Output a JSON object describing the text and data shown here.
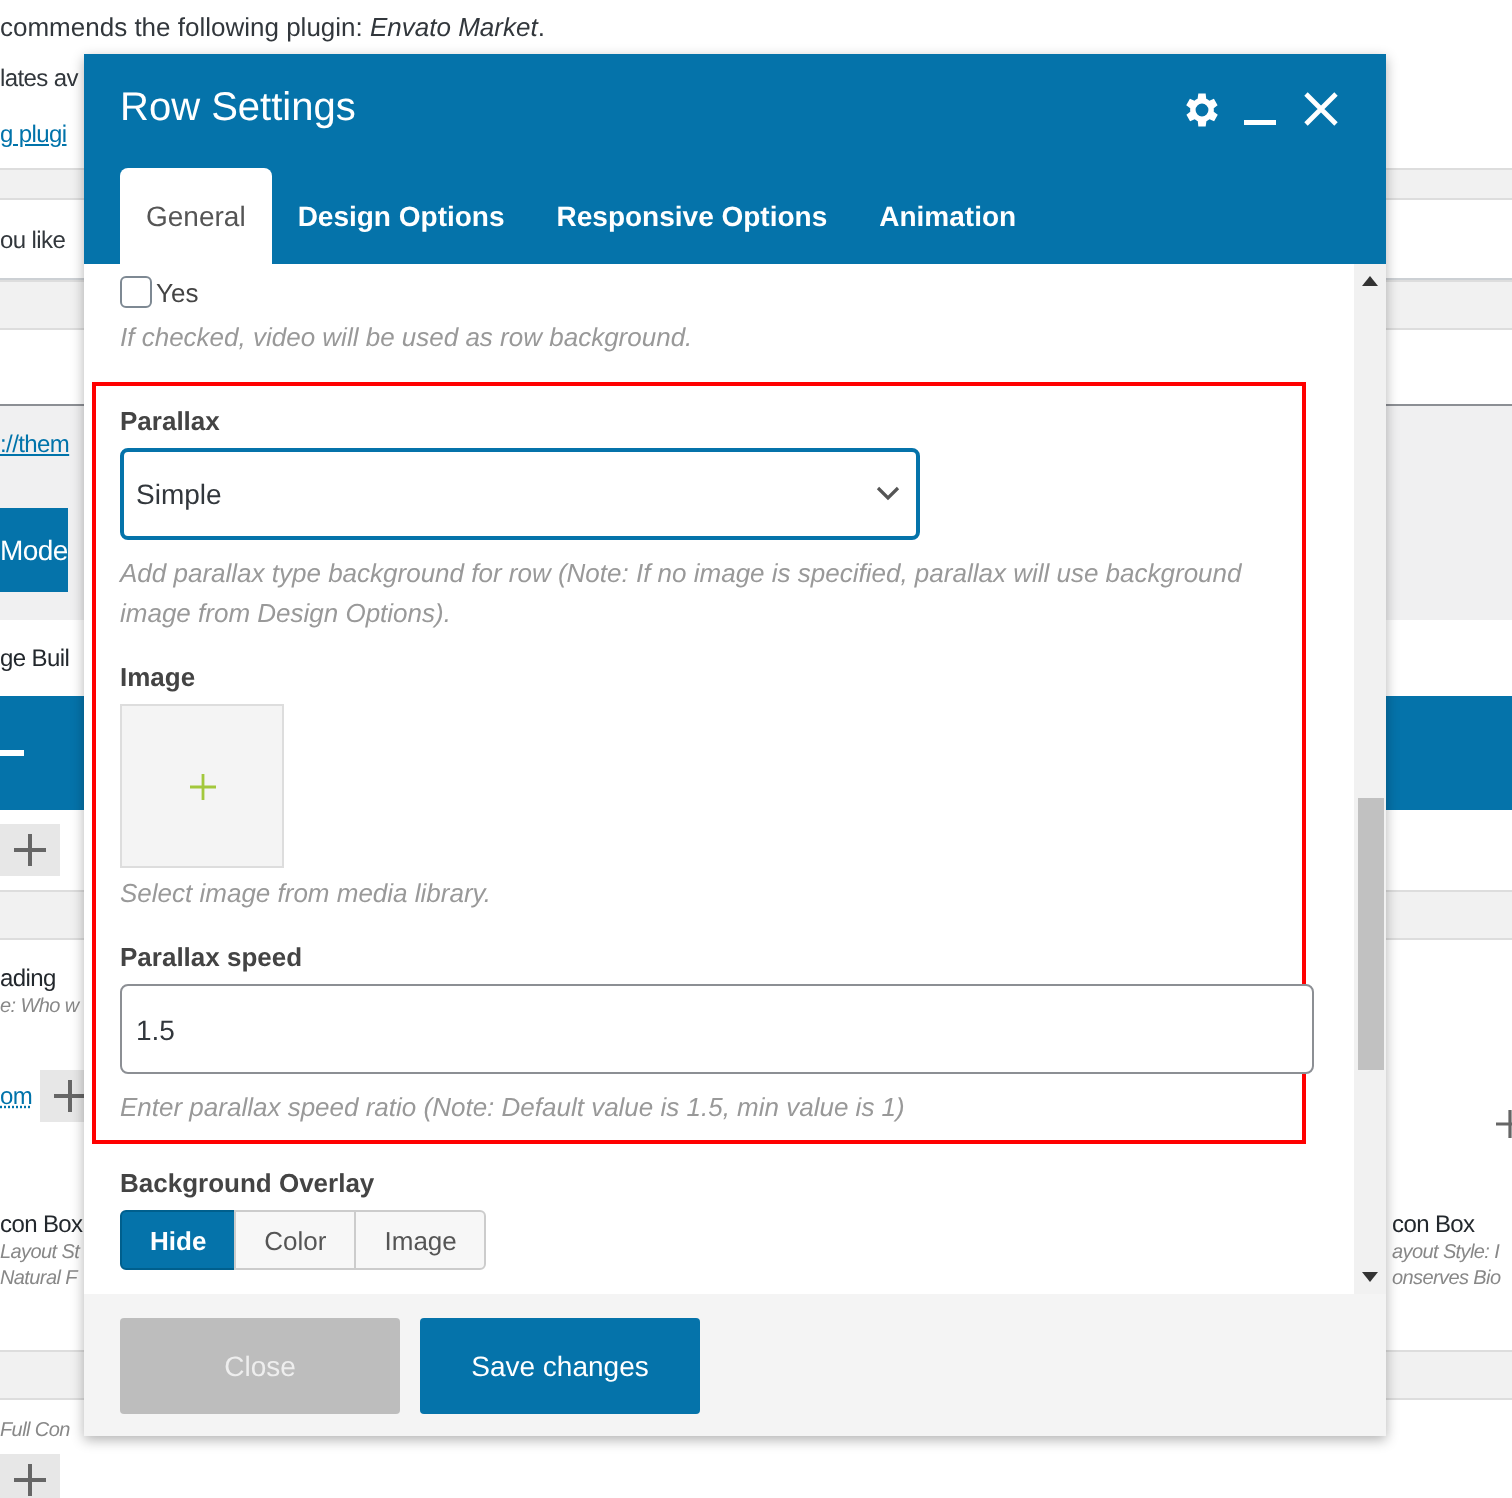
{
  "page": {
    "notice": "commends the following plugin: *Envato Market*.",
    "rows": [
      {
        "kind": "text",
        "left": "lates av"
      },
      {
        "kind": "link",
        "left": "g plugi"
      },
      {
        "kind": "band"
      },
      {
        "kind": "text",
        "left": "ou like"
      },
      {
        "kind": "band"
      },
      {
        "kind": "blank"
      },
      {
        "kind": "link-gray",
        "left": "://them"
      },
      {
        "kind": "button",
        "left": "Mode"
      },
      {
        "kind": "heading",
        "left": "ge Buil"
      },
      {
        "kind": "bar"
      },
      {
        "kind": "add"
      },
      {
        "kind": "band"
      },
      {
        "kind": "element",
        "left": "ading",
        "left_sub": [
          "e: Who w"
        ]
      },
      {
        "kind": "add-link",
        "left": "om",
        "right_add": true
      },
      {
        "kind": "element",
        "left": "con Box",
        "left_sub": [
          "Layout St",
          "Natural F"
        ],
        "right": "con Box",
        "right_sub": [
          "ayout Style: I",
          "onserves Bio"
        ]
      },
      {
        "kind": "band"
      },
      {
        "kind": "sub",
        "left": "Full  Con"
      },
      {
        "kind": "add"
      }
    ]
  },
  "modal": {
    "title": "Row Settings",
    "tabs": [
      {
        "label": "General",
        "selected": true
      },
      {
        "label": "Design Options",
        "selected": false
      },
      {
        "label": "Responsive Options",
        "selected": false
      },
      {
        "label": "Animation",
        "selected": false
      }
    ],
    "fields": [
      {
        "kind": "checkbox",
        "label": "Yes",
        "checked": false,
        "help": "If checked, video will be used as row background."
      },
      {
        "kind": "highlight-group",
        "fields": [
          {
            "kind": "select",
            "label": "Parallax",
            "value": "Simple",
            "help": "Add parallax type background for row (Note: If no image is specified, parallax will use background image from Design Options)."
          },
          {
            "kind": "image",
            "label": "Image",
            "help": "Select image from media library."
          },
          {
            "kind": "text",
            "label": "Parallax speed",
            "value": "1.5",
            "help": "Enter parallax speed ratio (Note: Default value is 1.5, min value is 1)"
          }
        ]
      },
      {
        "kind": "segmented",
        "label": "Background Overlay",
        "options": [
          {
            "label": "Hide",
            "selected": true
          },
          {
            "label": "Color",
            "selected": false
          },
          {
            "label": "Image",
            "selected": false
          }
        ]
      }
    ],
    "buttons": [
      {
        "label": "Close",
        "kind": "secondary"
      },
      {
        "label": "Save changes",
        "kind": "primary"
      }
    ]
  }
}
